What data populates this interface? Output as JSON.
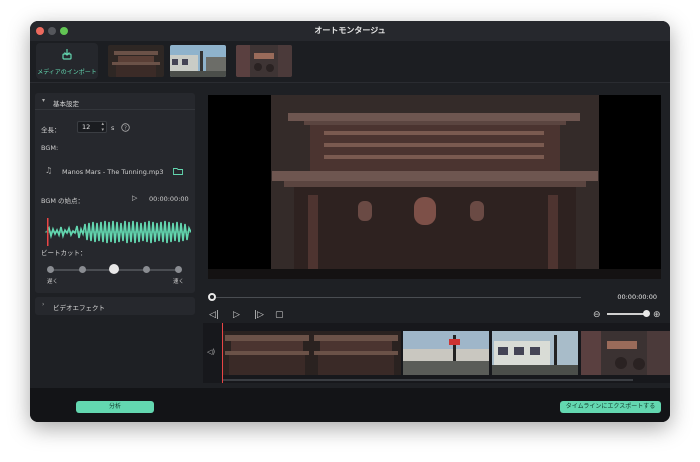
{
  "window": {
    "title": "オートモンタージュ"
  },
  "toolbar": {
    "import_label": "メディアのインポート"
  },
  "basic": {
    "title": "基本設定",
    "length_label": "全長：",
    "length_value": "12",
    "length_unit": "s",
    "bgm_label": "BGM:",
    "bgm_file": "Manos Mars - The Tunning.mp3",
    "bgm_start_label": "BGM の始点：",
    "bgm_start_time": "00:00:00:00",
    "beat_cut_label": "ビートカット：",
    "slow_label": "遅く",
    "fast_label": "速く",
    "beat_cut_level": 0.5
  },
  "video_effect": {
    "title": "ビデオエフェクト"
  },
  "preview": {
    "timecode": "00:00:00:00"
  },
  "bottom": {
    "analyze_label": "分析",
    "export_label": "タイムラインにエクスポートする"
  },
  "colors": {
    "accent": "#63d7b0",
    "playhead": "#e94545"
  }
}
